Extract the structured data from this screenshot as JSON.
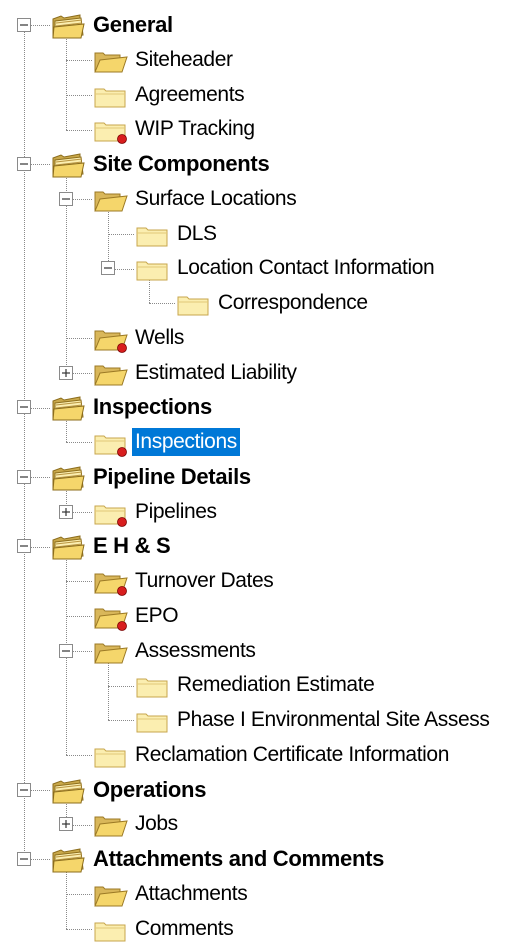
{
  "tree": {
    "items": [
      {
        "label": "General",
        "level": 0,
        "bold": true,
        "icon": "folder-stack-icon",
        "expander": "minus"
      },
      {
        "label": "Siteheader",
        "level": 1,
        "icon": "folder-open-icon"
      },
      {
        "label": "Agreements",
        "level": 1,
        "icon": "folder-closed-icon"
      },
      {
        "label": "WIP Tracking",
        "level": 1,
        "icon": "folder-alert-icon"
      },
      {
        "label": "Site Components",
        "level": 0,
        "bold": true,
        "icon": "folder-stack-icon",
        "expander": "minus"
      },
      {
        "label": "Surface Locations",
        "level": 1,
        "icon": "folder-open-icon",
        "expander": "minus"
      },
      {
        "label": "DLS",
        "level": 2,
        "icon": "folder-closed-icon"
      },
      {
        "label": "Location Contact Information",
        "level": 2,
        "icon": "folder-closed-icon",
        "expander": "minus"
      },
      {
        "label": "Correspondence",
        "level": 3,
        "icon": "folder-closed-icon"
      },
      {
        "label": "Wells",
        "level": 1,
        "icon": "folder-open-alert-icon"
      },
      {
        "label": "Estimated Liability",
        "level": 1,
        "icon": "folder-open-icon",
        "expander": "plus"
      },
      {
        "label": "Inspections",
        "level": 0,
        "bold": true,
        "icon": "folder-stack-icon",
        "expander": "minus"
      },
      {
        "label": "Inspections",
        "level": 1,
        "icon": "folder-alert-icon",
        "selected": true
      },
      {
        "label": "Pipeline Details",
        "level": 0,
        "bold": true,
        "icon": "folder-stack-icon",
        "expander": "minus"
      },
      {
        "label": "Pipelines",
        "level": 1,
        "icon": "folder-alert-icon",
        "expander": "plus"
      },
      {
        "label": "E H & S",
        "level": 0,
        "bold": true,
        "icon": "folder-stack-icon",
        "expander": "minus"
      },
      {
        "label": "Turnover Dates",
        "level": 1,
        "icon": "folder-open-alert-icon"
      },
      {
        "label": "EPO",
        "level": 1,
        "icon": "folder-open-alert-icon"
      },
      {
        "label": "Assessments",
        "level": 1,
        "icon": "folder-open-icon",
        "expander": "minus"
      },
      {
        "label": "Remediation Estimate",
        "level": 2,
        "icon": "folder-closed-icon"
      },
      {
        "label": "Phase I Environmental Site Assess",
        "level": 2,
        "icon": "folder-closed-icon"
      },
      {
        "label": "Reclamation Certificate Information",
        "level": 1,
        "icon": "folder-closed-icon"
      },
      {
        "label": "Operations",
        "level": 0,
        "bold": true,
        "icon": "folder-stack-icon",
        "expander": "minus"
      },
      {
        "label": "Jobs",
        "level": 1,
        "icon": "folder-open-icon",
        "expander": "plus"
      },
      {
        "label": "Attachments and Comments",
        "level": 0,
        "bold": true,
        "icon": "folder-stack-icon",
        "expander": "minus"
      },
      {
        "label": "Attachments",
        "level": 1,
        "icon": "folder-open-icon"
      },
      {
        "label": "Comments",
        "level": 1,
        "icon": "folder-closed-icon"
      }
    ],
    "colors": {
      "selection": "#0078d7",
      "folder": "#f5d66b",
      "folder_light": "#fbeeb0",
      "alert": "#d81e1e",
      "connector": "#8a8a8a"
    }
  }
}
